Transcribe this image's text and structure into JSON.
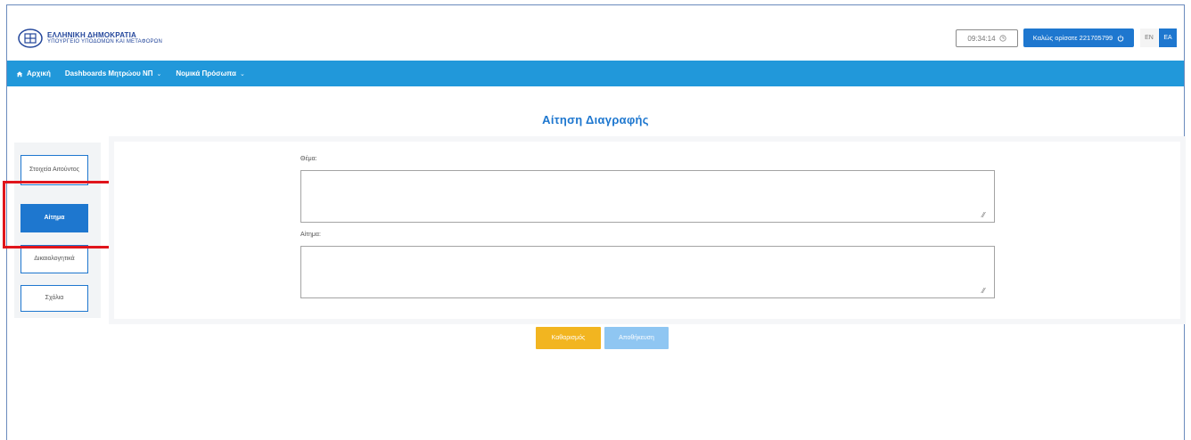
{
  "header": {
    "brand_title": "ΕΛΛΗΝΙΚΗ ΔΗΜΟΚΡΑΤΙΑ",
    "brand_subtitle": "ΥΠΟΥΡΓΕΙΟ ΥΠΟΔΟΜΩΝ ΚΑΙ ΜΕΤΑΦΟΡΩΝ",
    "clock": "09:34:14",
    "welcome": "Καλώς ορίσατε 221705799",
    "lang_en": "EN",
    "lang_el": "EA"
  },
  "nav": {
    "home": "Αρχική",
    "dashboards": "Dashboards Μητρώου ΝΠ",
    "legal_entities": "Νομικά Πρόσωπα"
  },
  "page": {
    "title": "Αίτηση Διαγραφής"
  },
  "sidebar": {
    "items": [
      {
        "label": "Στοιχεία Αιτούντος"
      },
      {
        "label": "Αίτημα"
      },
      {
        "label": "Δικαιολογητικά"
      },
      {
        "label": "Σχόλια"
      }
    ]
  },
  "form": {
    "subject_label": "Θέμα:",
    "request_label": "Αίτημα:",
    "subject_value": "",
    "request_value": ""
  },
  "buttons": {
    "clear": "Καθαρισμός",
    "save": "Αποθήκευση"
  },
  "colors": {
    "accent": "#1e77cf",
    "nav": "#2198da",
    "clear_button": "#f2b520",
    "save_button": "#8fc6f2",
    "highlight": "#e0151c"
  }
}
